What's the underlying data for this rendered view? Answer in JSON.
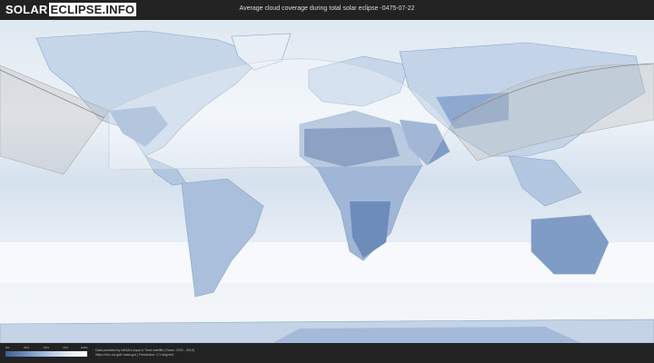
{
  "header": {
    "logo_part1": "SOLAR",
    "logo_part2": "ECLIPSE.INFO",
    "title": "Average cloud coverage during total solar eclipse -0475-07-22"
  },
  "legend": {
    "ticks": [
      "0%",
      "25%",
      "50%",
      "75%",
      "100%"
    ],
    "colors": [
      "#3f5f92",
      "#6f8fbe",
      "#a8c1df",
      "#dde8f3",
      "#ffffff"
    ]
  },
  "footer": {
    "credit_line1": "Data provided by NASA's Aqua & Terra satellite (Years: 2003 - 2019)",
    "credit_line2": "https://neo.sci.gsfc.nasa.gov | Resolution: 0.1 degrees"
  },
  "map_style": {
    "ocean": "#e9eff6",
    "land_cloudy": "#b9cce3",
    "land_clear": "#5f7fae",
    "eclipse_band": "#d8d8d8",
    "eclipse_path": "#888888"
  }
}
